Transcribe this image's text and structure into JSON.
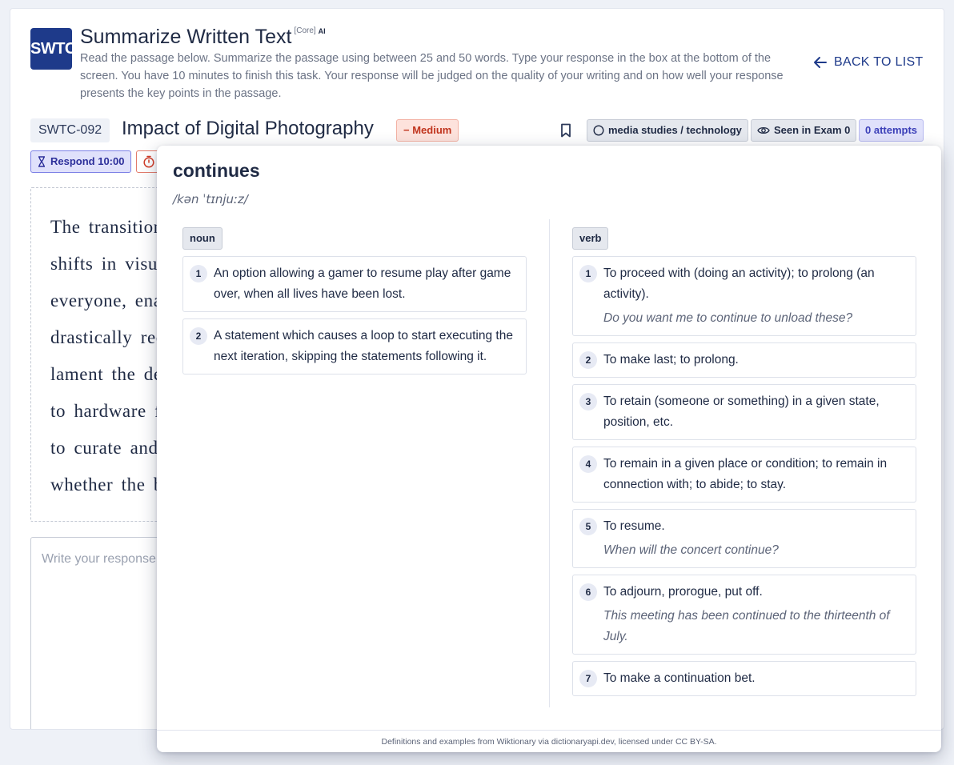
{
  "header": {
    "logo_text": "SWTC",
    "title": "Summarize Written Text",
    "tag_core": "[Core]",
    "tag_ai": "AI",
    "instructions": "Read the passage below. Summarize the passage using between 25 and 50 words. Type your response in the box at the bottom of the screen. You have 10 minutes to finish this task. Your response will be judged on the quality of your writing and on how well your response presents the key points in the passage.",
    "back_label": "BACK TO LIST"
  },
  "question": {
    "id": "SWTC-092",
    "title": "Impact of Digital Photography",
    "difficulty": "Medium",
    "topic": "media studies / technology",
    "seen": "Seen in Exam 0",
    "attempts": "0 attempts",
    "respond": "Respond 10:00"
  },
  "passage": {
    "lines": [
      "The transition",
      "shifts in visua",
      "everyone, ena",
      "drastically red",
      "lament the dec",
      "to hardware fa",
      "to curate and",
      "whether the be"
    ]
  },
  "response": {
    "placeholder": "Write your response here..."
  },
  "dictionary": {
    "word": "continues",
    "phonetic": "/kən ˈtɪnjuːz/",
    "noun": {
      "label": "noun",
      "definitions": [
        {
          "text": "An option allowing a gamer to resume play after game over, when all lives have been lost."
        },
        {
          "text": "A statement which causes a loop to start executing the next iteration, skipping the statements following it."
        }
      ]
    },
    "verb": {
      "label": "verb",
      "definitions": [
        {
          "text": "To proceed with (doing an activity); to prolong (an activity).",
          "example": "Do you want me to continue to unload these?"
        },
        {
          "text": "To make last; to prolong."
        },
        {
          "text": "To retain (someone or something) in a given state, position, etc."
        },
        {
          "text": "To remain in a given place or condition; to remain in connection with; to abide; to stay."
        },
        {
          "text": "To resume.",
          "example": "When will the concert continue?"
        },
        {
          "text": "To adjourn, prorogue, put off.",
          "example": "This meeting has been continued to the thirteenth of July."
        },
        {
          "text": "To make a continuation bet."
        }
      ]
    },
    "footer": "Definitions and examples from Wiktionary via dictionaryapi.dev, licensed under CC BY-SA."
  }
}
